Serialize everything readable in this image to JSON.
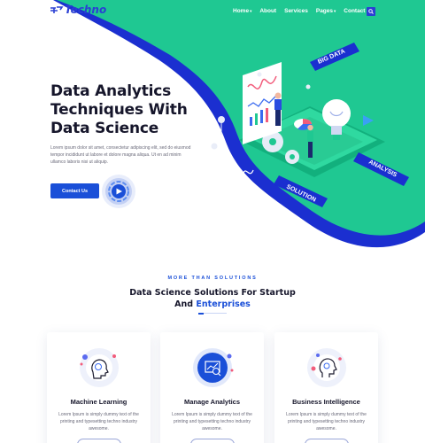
{
  "brand": {
    "name": "Techno"
  },
  "colors": {
    "primary": "#1a4fd8",
    "teal": "#1fc892",
    "navy": "#2a3fd4",
    "heading": "#16162b",
    "muted": "#6a6a7a"
  },
  "nav": {
    "items": [
      {
        "label": "Home",
        "has_dropdown": true
      },
      {
        "label": "About",
        "has_dropdown": false
      },
      {
        "label": "Services",
        "has_dropdown": false
      },
      {
        "label": "Pages",
        "has_dropdown": true
      },
      {
        "label": "Contact Us",
        "has_dropdown": false
      }
    ],
    "search_icon": "search-icon"
  },
  "hero": {
    "title_lines": [
      "Data Analytics",
      "Techniques With",
      "Data Science"
    ],
    "text": "Lorem ipsum dolor sit amet, consectetur adipiscing elit, sed do eiusmod tempor incididunt ut labore et dolore magna aliqua. Ut en ad minim ullamco laboris nisi ut aliquip.",
    "cta_label": "Contact Us",
    "play_icon": "play-icon",
    "tags": [
      "BIG DATA",
      "ANALYSIS",
      "SOLUTION"
    ]
  },
  "section": {
    "kicker": "MORE THAN SOLUTIONS",
    "title_line1": "Data Science Solutions For Startup",
    "title_line2_prefix": "And",
    "title_line2_accent": "Enterprises"
  },
  "cards": [
    {
      "title": "Machine Learning",
      "icon": "brain-icon",
      "highlight": false,
      "text": "Lorem Ipsum is simply dummy text of the printing and typesetting techno industry awesome."
    },
    {
      "title": "Manage Analytics",
      "icon": "analytics-icon",
      "highlight": true,
      "text": "Lorem Ipsum is simply dummy text of the printing and typesetting techno industry awesome."
    },
    {
      "title": "Business Intelligence",
      "icon": "head-gear-icon",
      "highlight": false,
      "text": "Lorem Ipsum is simply dummy text of the printing and typesetting techno industry awesome."
    }
  ]
}
